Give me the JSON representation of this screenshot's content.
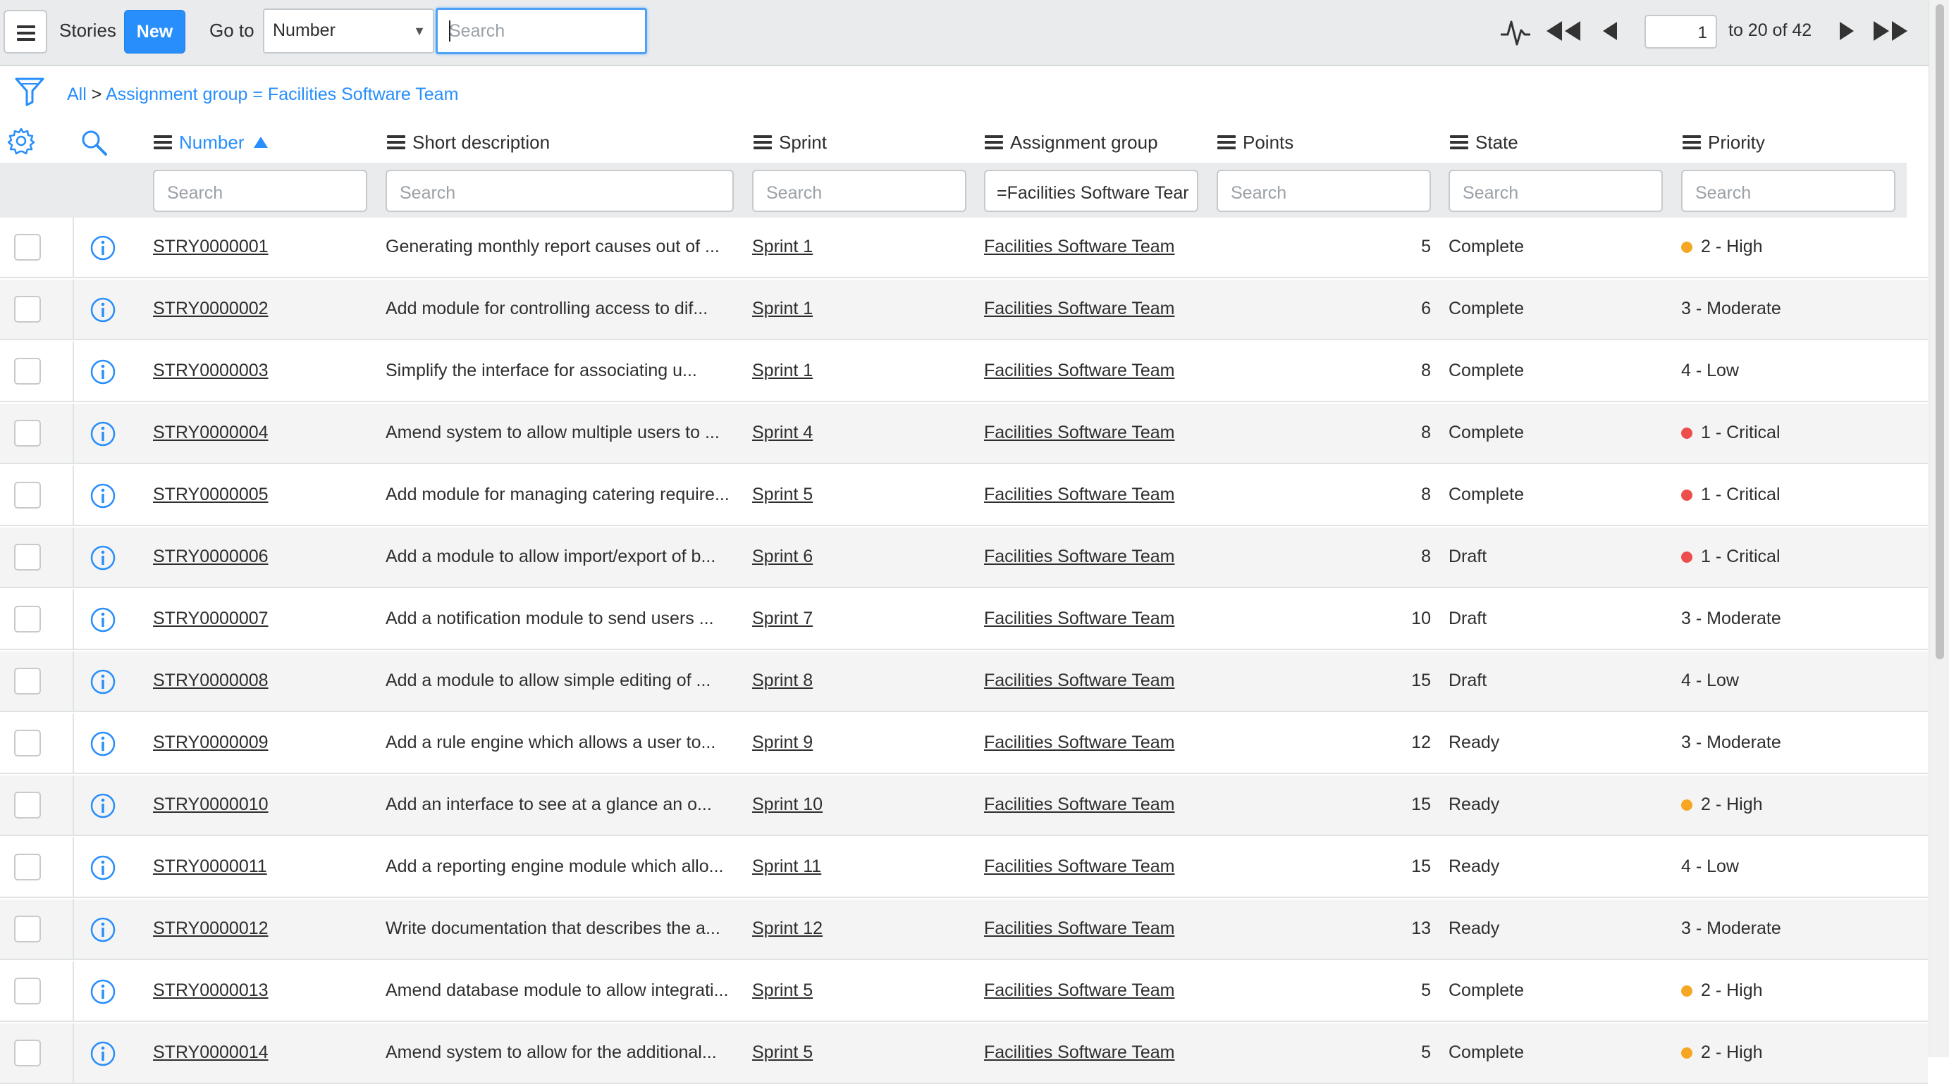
{
  "header": {
    "title": "Stories",
    "new_label": "New",
    "goto_label": "Go to",
    "goto_field": "Number",
    "search_placeholder": "Search",
    "pager_current": "1",
    "pager_range": "to 20 of 42"
  },
  "breadcrumb": {
    "root": "All",
    "separator": ">",
    "condition": "Assignment group = Facilities Software Team"
  },
  "columns": {
    "number": "Number",
    "short_description": "Short description",
    "sprint": "Sprint",
    "assignment_group": "Assignment group",
    "points": "Points",
    "state": "State",
    "priority": "Priority"
  },
  "filters": {
    "number": "Search",
    "short_description": "Search",
    "sprint": "Search",
    "assignment_group": "=Facilities Software Tear",
    "points": "Search",
    "state": "Search",
    "priority": "Search"
  },
  "priority_colors": {
    "high": "#f5a623",
    "critical": "#ee4e4b"
  },
  "rows": [
    {
      "number": "STRY0000001",
      "short_description": "Generating monthly report causes out of ...",
      "sprint": "Sprint 1",
      "group": "Facilities Software Team",
      "points": "5",
      "state": "Complete",
      "priority": "2 - High",
      "dot": "high"
    },
    {
      "number": "STRY0000002",
      "short_description": "Add module for controlling access to dif...",
      "sprint": "Sprint 1",
      "group": "Facilities Software Team",
      "points": "6",
      "state": "Complete",
      "priority": "3 - Moderate",
      "dot": ""
    },
    {
      "number": "STRY0000003",
      "short_description": "Simplify the interface for associating u...",
      "sprint": "Sprint 1",
      "group": "Facilities Software Team",
      "points": "8",
      "state": "Complete",
      "priority": "4 - Low",
      "dot": ""
    },
    {
      "number": "STRY0000004",
      "short_description": "Amend system to allow multiple users to ...",
      "sprint": "Sprint 4",
      "group": "Facilities Software Team",
      "points": "8",
      "state": "Complete",
      "priority": "1 - Critical",
      "dot": "critical"
    },
    {
      "number": "STRY0000005",
      "short_description": "Add module for managing catering require...",
      "sprint": "Sprint 5",
      "group": "Facilities Software Team",
      "points": "8",
      "state": "Complete",
      "priority": "1 - Critical",
      "dot": "critical"
    },
    {
      "number": "STRY0000006",
      "short_description": "Add a module to allow import/export of b...",
      "sprint": "Sprint 6",
      "group": "Facilities Software Team",
      "points": "8",
      "state": "Draft",
      "priority": "1 - Critical",
      "dot": "critical"
    },
    {
      "number": "STRY0000007",
      "short_description": "Add a notification module to send users ...",
      "sprint": "Sprint 7",
      "group": "Facilities Software Team",
      "points": "10",
      "state": "Draft",
      "priority": "3 - Moderate",
      "dot": ""
    },
    {
      "number": "STRY0000008",
      "short_description": "Add a module to allow simple editing of ...",
      "sprint": "Sprint 8",
      "group": "Facilities Software Team",
      "points": "15",
      "state": "Draft",
      "priority": "4 - Low",
      "dot": ""
    },
    {
      "number": "STRY0000009",
      "short_description": "Add a rule engine which allows a user to...",
      "sprint": "Sprint 9",
      "group": "Facilities Software Team",
      "points": "12",
      "state": "Ready",
      "priority": "3 - Moderate",
      "dot": ""
    },
    {
      "number": "STRY0000010",
      "short_description": "Add an interface to see at a glance an o...",
      "sprint": "Sprint 10",
      "group": "Facilities Software Team",
      "points": "15",
      "state": "Ready",
      "priority": "2 - High",
      "dot": "high"
    },
    {
      "number": "STRY0000011",
      "short_description": "Add a reporting engine module which allo...",
      "sprint": "Sprint 11",
      "group": "Facilities Software Team",
      "points": "15",
      "state": "Ready",
      "priority": "4 - Low",
      "dot": ""
    },
    {
      "number": "STRY0000012",
      "short_description": "Write documentation that describes the a...",
      "sprint": "Sprint 12",
      "group": "Facilities Software Team",
      "points": "13",
      "state": "Ready",
      "priority": "3 - Moderate",
      "dot": ""
    },
    {
      "number": "STRY0000013",
      "short_description": "Amend database module to allow integrati...",
      "sprint": "Sprint 5",
      "group": "Facilities Software Team",
      "points": "5",
      "state": "Complete",
      "priority": "2 - High",
      "dot": "high"
    },
    {
      "number": "STRY0000014",
      "short_description": "Amend system to allow for the additional...",
      "sprint": "Sprint 5",
      "group": "Facilities Software Team",
      "points": "5",
      "state": "Complete",
      "priority": "2 - High",
      "dot": "high"
    }
  ]
}
